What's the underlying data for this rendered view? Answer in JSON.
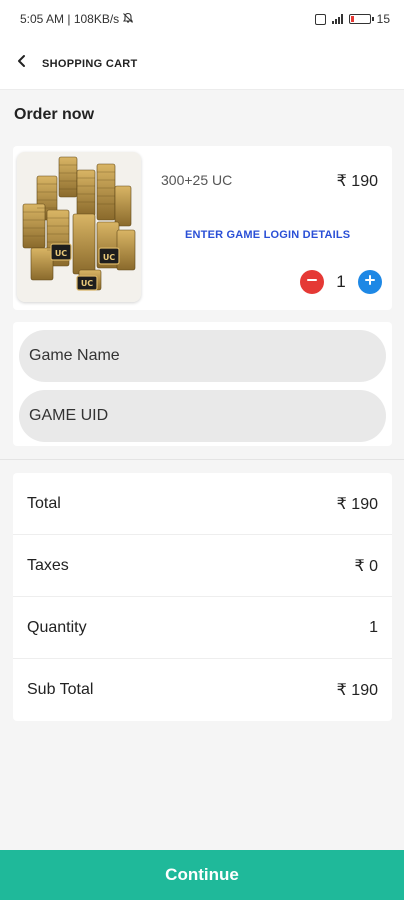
{
  "status_bar": {
    "time_network": "5:05 AM | 108KB/s",
    "battery_text": "15"
  },
  "header": {
    "title": "SHOPPING CART"
  },
  "order": {
    "section_title": "Order now",
    "product": {
      "name": "300+25 UC",
      "price": "₹ 190",
      "login_link": "ENTER GAME LOGIN DETAILS",
      "quantity": "1",
      "image_text": "UC"
    }
  },
  "login_form": {
    "game_name_placeholder": "Game Name",
    "game_uid_placeholder": "GAME UID"
  },
  "summary": {
    "rows": [
      {
        "label": "Total",
        "value": "₹ 190"
      },
      {
        "label": "Taxes",
        "value": "₹ 0"
      },
      {
        "label": "Quantity",
        "value": "1"
      },
      {
        "label": "Sub Total",
        "value": "₹ 190"
      }
    ]
  },
  "footer": {
    "continue_label": "Continue"
  },
  "colors": {
    "accent": "#1fb99a",
    "link": "#2a4fd6",
    "minus": "#e53935",
    "plus": "#1e88e5"
  }
}
